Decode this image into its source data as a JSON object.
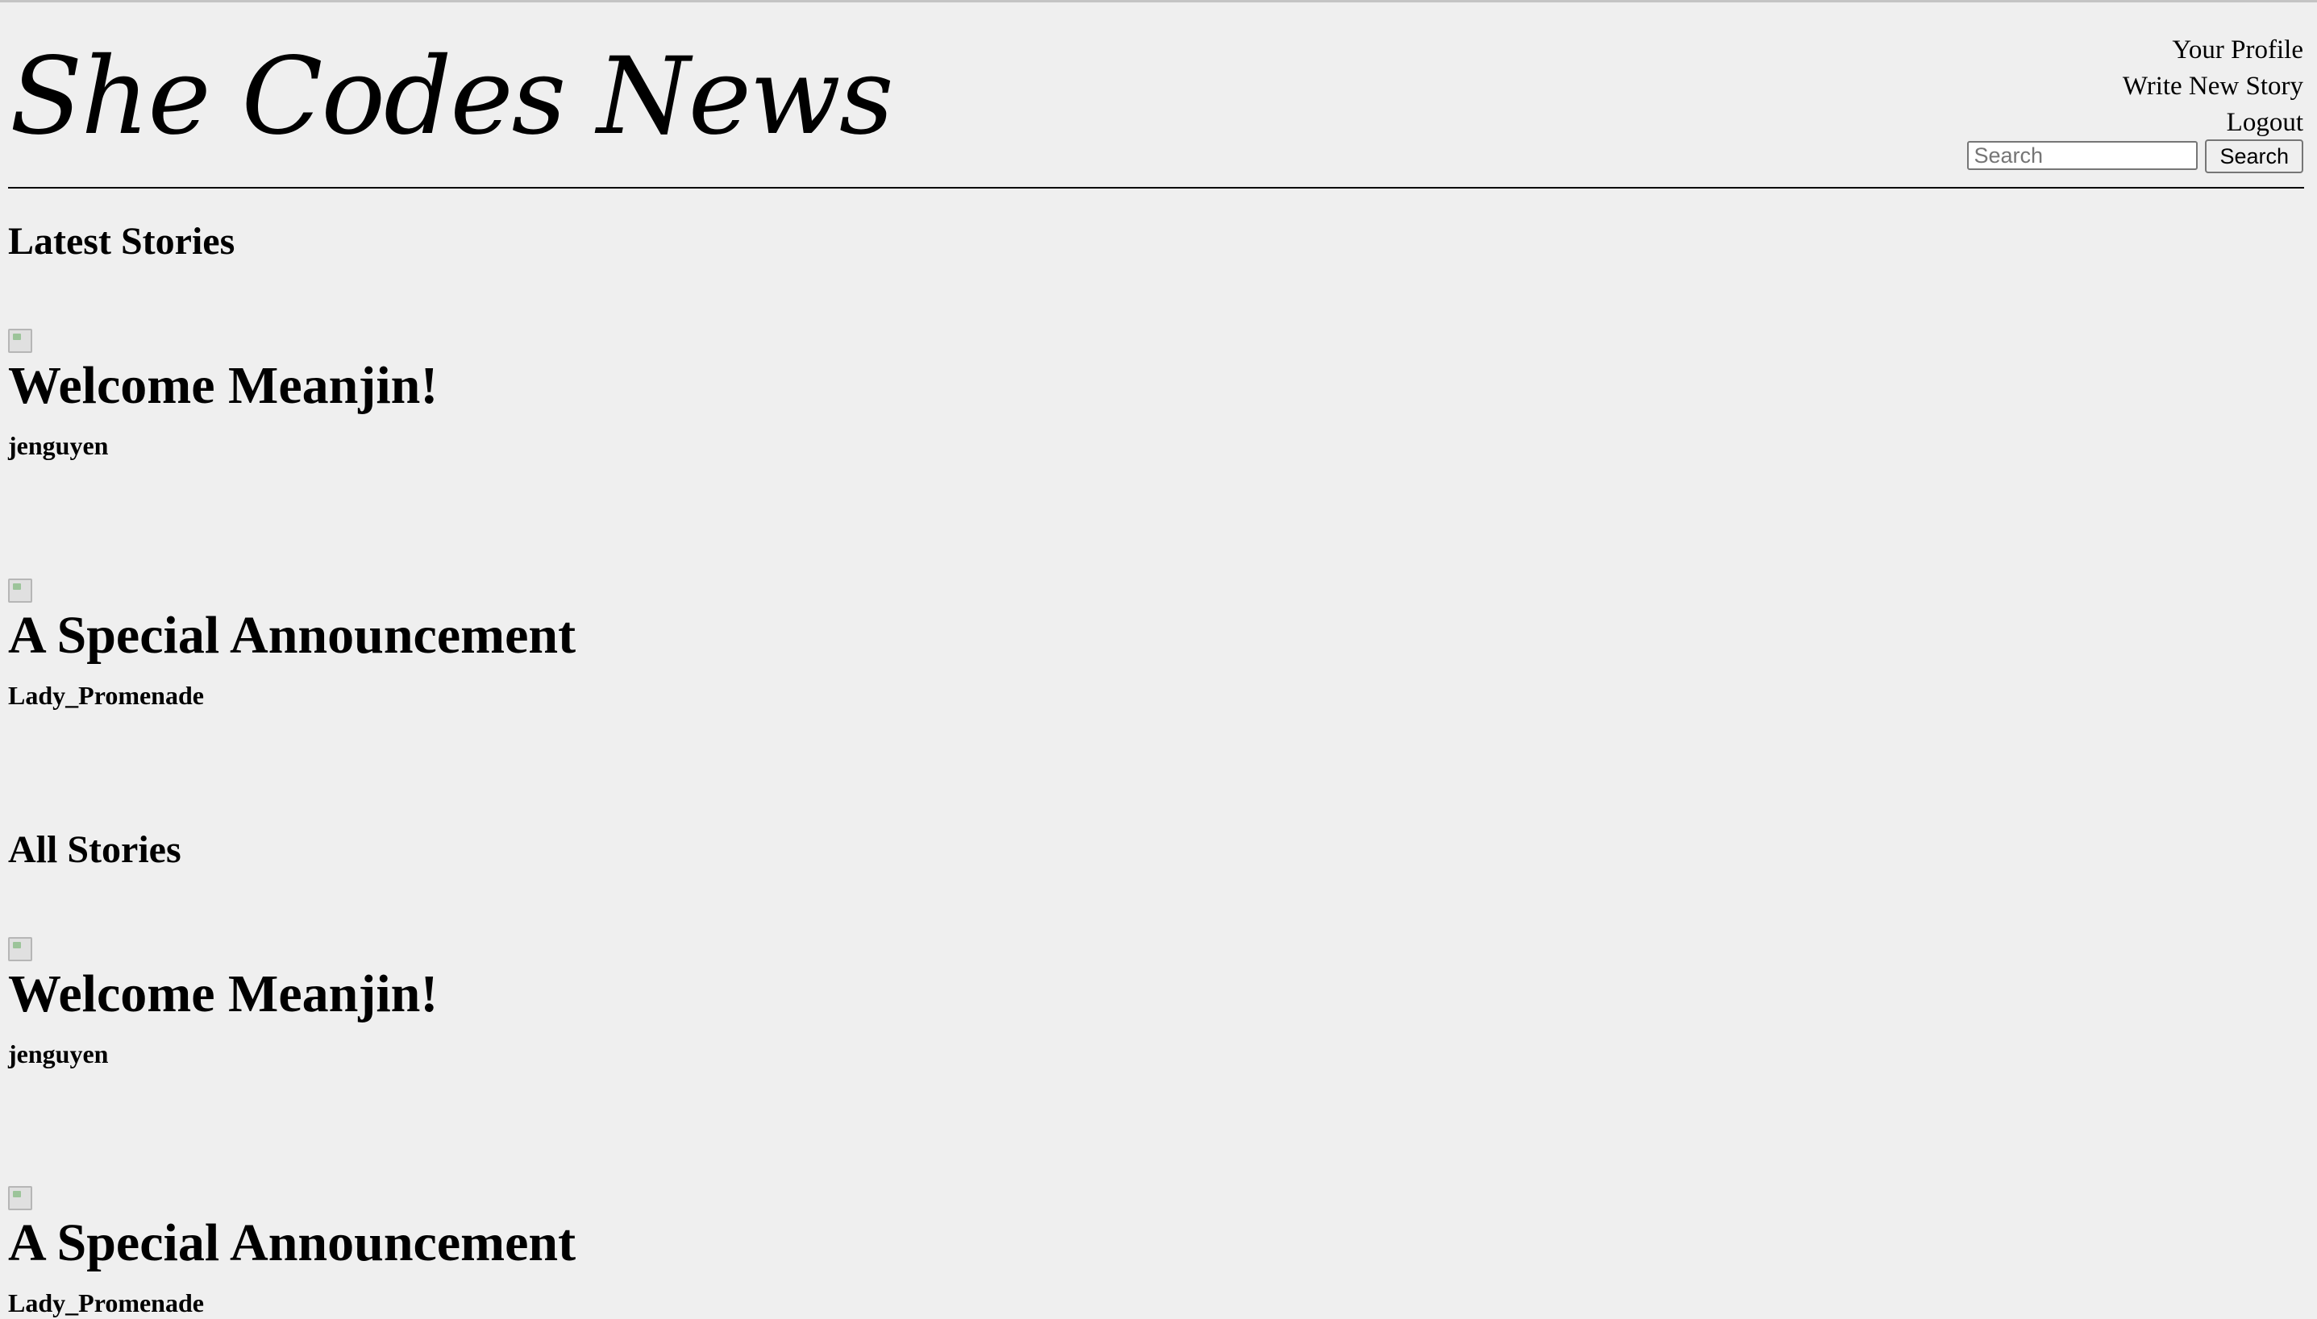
{
  "header": {
    "logo_text": "She Codes News",
    "nav": [
      "Your Profile",
      "Write New Story",
      "Logout"
    ],
    "search": {
      "placeholder": "Search",
      "button_label": "Search"
    }
  },
  "latest": {
    "heading": "Latest Stories",
    "stories": [
      {
        "title": "Welcome Meanjin!",
        "author": "jenguyen"
      },
      {
        "title": "A Special Announcement",
        "author": "Lady_Promenade"
      }
    ]
  },
  "all": {
    "heading": "All Stories",
    "stories": [
      {
        "title": "Welcome Meanjin!",
        "author": "jenguyen"
      },
      {
        "title": "A Special Announcement",
        "author": "Lady_Promenade"
      }
    ]
  }
}
